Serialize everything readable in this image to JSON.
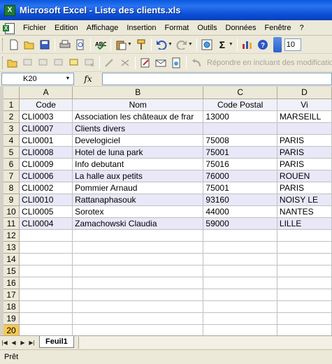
{
  "window": {
    "title": "Microsoft Excel - Liste des clients.xls",
    "app_icon": "excel-icon"
  },
  "menu": {
    "items": [
      "Fichier",
      "Edition",
      "Affichage",
      "Insertion",
      "Format",
      "Outils",
      "Données",
      "Fenêtre"
    ],
    "help": "?"
  },
  "toolbar": {
    "font_size": "10",
    "buttons": [
      "new-icon",
      "open-icon",
      "save-icon",
      "print-icon",
      "print-preview-icon",
      "spelling-icon",
      "paste-icon",
      "format-painter-icon",
      "undo-icon",
      "redo-icon",
      "insert-hyperlink-icon",
      "autosum-icon",
      "chart-icon",
      "help-icon"
    ]
  },
  "reviewing_toolbar": {
    "reply_label": "Répondre en incluant des modifications"
  },
  "formula_bar": {
    "name_box": "K20",
    "fx_label": "fx",
    "formula": ""
  },
  "sheet": {
    "columns": [
      "A",
      "B",
      "C",
      "D"
    ],
    "row_numbers": [
      "1",
      "2",
      "3",
      "4",
      "5",
      "6",
      "7",
      "8",
      "9",
      "10",
      "11",
      "12",
      "13",
      "14",
      "15",
      "16",
      "17",
      "18",
      "19",
      "20"
    ],
    "headers": [
      "Code",
      "Nom",
      "Code Postal",
      "Vi"
    ],
    "rows": [
      [
        "CLI0003",
        "Association les châteaux de frar",
        "13000",
        "MARSEILL"
      ],
      [
        "CLI0007",
        "Clients divers",
        "",
        ""
      ],
      [
        "CLI0001",
        "Develogiciel",
        "75008",
        "PARIS"
      ],
      [
        "CLI0008",
        "Hotel de luna park",
        "75001",
        "PARIS"
      ],
      [
        "CLI0009",
        "Info debutant",
        "75016",
        "PARIS"
      ],
      [
        "CLI0006",
        "La halle aux petits",
        "76000",
        "ROUEN"
      ],
      [
        "CLI0002",
        "Pommier Arnaud",
        "75001",
        "PARIS"
      ],
      [
        "CLI0010",
        "Rattanaphasouk",
        "93160",
        "NOISY LE"
      ],
      [
        "CLI0005",
        "Sorotex",
        "44000",
        "NANTES"
      ],
      [
        "CLI0004",
        "Zamachowski Claudia",
        "59000",
        "LILLE"
      ]
    ],
    "active_row": "20"
  },
  "tabs": {
    "sheet_name": "Feuil1"
  },
  "status": {
    "text": "Prêt"
  }
}
